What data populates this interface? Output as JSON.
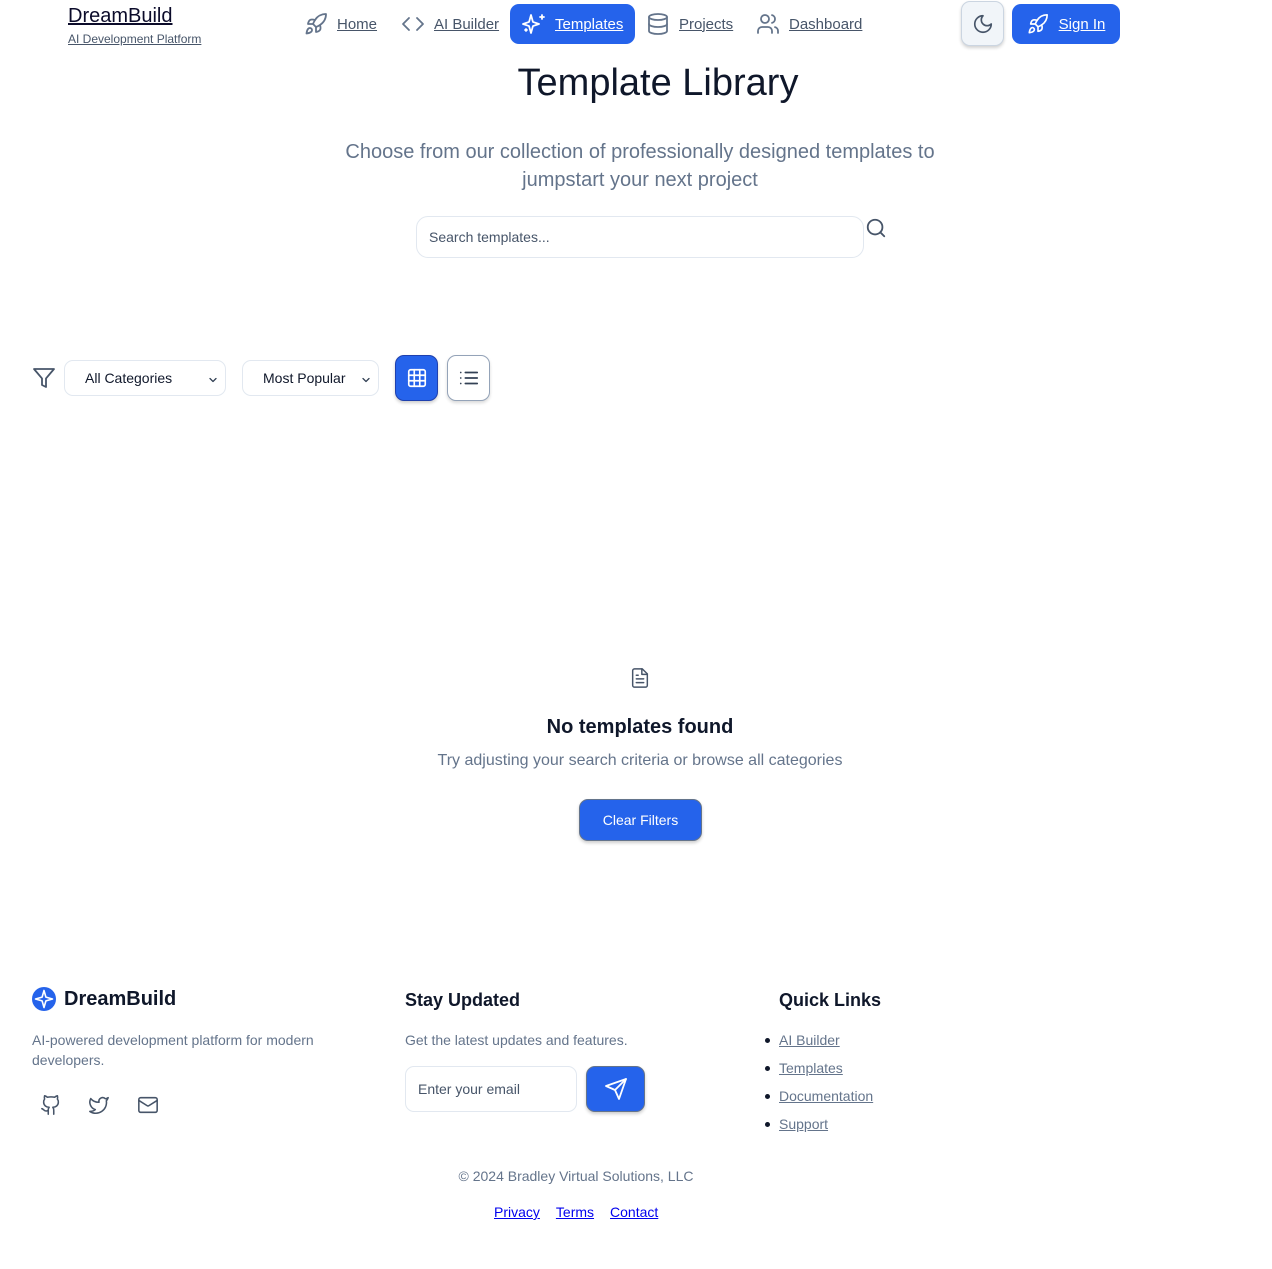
{
  "brand": {
    "name": "DreamBuild",
    "tagline": "AI Development Platform"
  },
  "nav": {
    "items": [
      {
        "label": "Home",
        "icon": "rocket-icon"
      },
      {
        "label": "AI Builder",
        "icon": "code-icon"
      },
      {
        "label": "Templates",
        "icon": "sparkles-icon",
        "active": true
      },
      {
        "label": "Projects",
        "icon": "database-icon"
      },
      {
        "label": "Dashboard",
        "icon": "users-icon"
      }
    ],
    "theme_toggle_icon": "moon-icon",
    "signin_label": "Sign In"
  },
  "hero": {
    "title": "Template Library",
    "subtitle": "Choose from our collection of professionally designed templates to jumpstart your next project",
    "search_placeholder": "Search templates...",
    "search_value": ""
  },
  "filters": {
    "category": "All Categories",
    "sort": "Most Popular",
    "view_mode": "grid"
  },
  "empty_state": {
    "title": "No templates found",
    "message": "Try adjusting your search criteria or browse all categories",
    "button_label": "Clear Filters"
  },
  "footer": {
    "brand_name": "DreamBuild",
    "description": "AI-powered development platform for modern developers.",
    "newsletter_title": "Stay Updated",
    "newsletter_text": "Get the latest updates and features.",
    "email_placeholder": "Enter your email",
    "quick_links_title": "Quick Links",
    "quick_links": [
      "AI Builder",
      "Templates",
      "Documentation",
      "Support"
    ],
    "copyright": "© 2024 Bradley Virtual Solutions, LLC",
    "legal_links": [
      "Privacy",
      "Terms",
      "Contact"
    ]
  },
  "colors": {
    "primary": "#2563eb",
    "text": "#0f172a",
    "muted": "#64748b",
    "border": "#e2e8f0"
  }
}
